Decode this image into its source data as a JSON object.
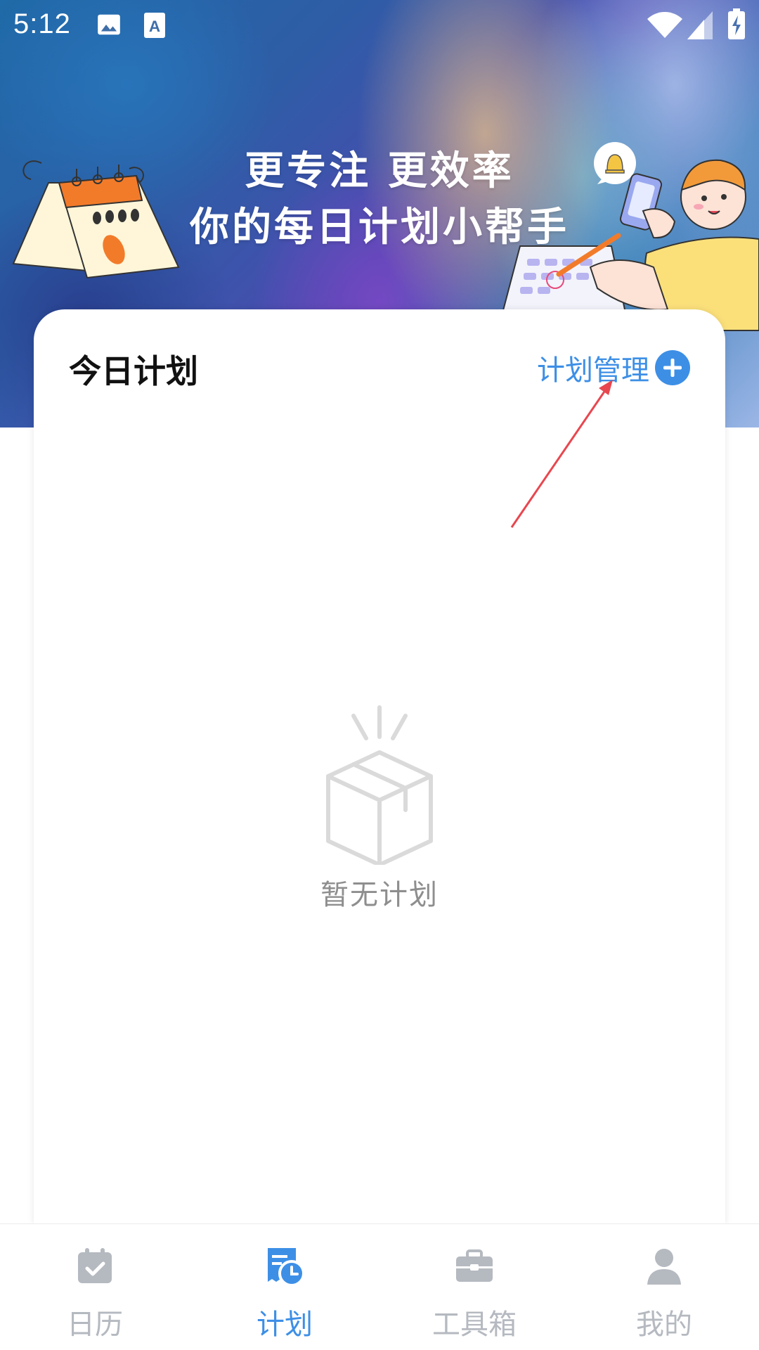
{
  "status_bar": {
    "time": "5:12",
    "icons": [
      "image-icon",
      "font-a-icon",
      "wifi-icon",
      "signal-icon",
      "battery-charging-icon"
    ]
  },
  "banner": {
    "headline_1": "更专注  更效率",
    "headline_2": "你的每日计划小帮手"
  },
  "card": {
    "title": "今日计划",
    "manage_label": "计划管理",
    "manage_icon": "plus-circle-icon",
    "empty_icon": "empty-box-icon",
    "empty_text": "暂无计划"
  },
  "bottom_nav": {
    "items": [
      {
        "label": "日历",
        "icon": "calendar-check-icon",
        "active": false
      },
      {
        "label": "计划",
        "icon": "plan-clock-icon",
        "active": true
      },
      {
        "label": "工具箱",
        "icon": "toolbox-icon",
        "active": false
      },
      {
        "label": "我的",
        "icon": "user-icon",
        "active": false
      }
    ]
  },
  "colors": {
    "accent": "#3d8fe6",
    "inactive": "#b5b9c0",
    "annotation_arrow": "#e8474f"
  }
}
